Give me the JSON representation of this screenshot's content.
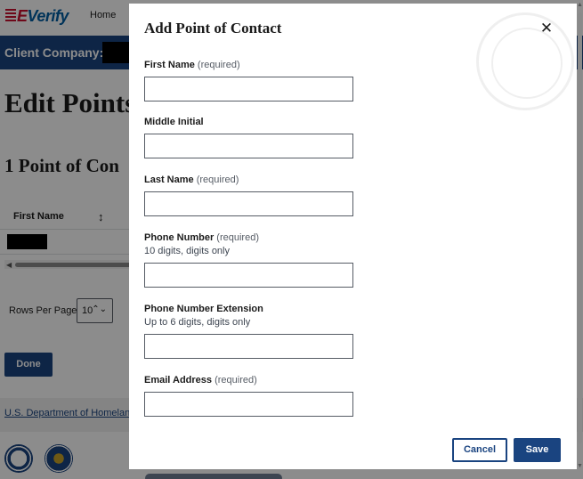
{
  "background": {
    "logo": {
      "prefix": "E",
      "text": "Verify"
    },
    "nav": {
      "home": "Home"
    },
    "client_company_label": "Client Company:",
    "page_title": "Edit Points",
    "poc_count": "1 Point of Con",
    "table": {
      "columns": [
        "First Name"
      ]
    },
    "rows_per_page": {
      "label": "Rows Per Page",
      "value": "10"
    },
    "done_label": "Done",
    "footer_link": "U.S. Department of Homelan"
  },
  "modal": {
    "title": "Add Point of Contact",
    "fields": [
      {
        "label": "First Name",
        "required": "(required)",
        "hint": "",
        "value": ""
      },
      {
        "label": "Middle Initial",
        "required": "",
        "hint": "",
        "value": ""
      },
      {
        "label": "Last Name",
        "required": "(required)",
        "hint": "",
        "value": ""
      },
      {
        "label": "Phone Number",
        "required": "(required)",
        "hint": "10 digits, digits only",
        "value": ""
      },
      {
        "label": "Phone Number Extension",
        "required": "",
        "hint": "Up to 6 digits, digits only",
        "value": ""
      },
      {
        "label": "Email Address",
        "required": "(required)",
        "hint": "",
        "value": ""
      }
    ],
    "cancel_label": "Cancel",
    "save_label": "Save"
  },
  "icons": {
    "close": "close-icon",
    "sort": "sort-icon",
    "chevron": "chevron-up-down-icon"
  },
  "colors": {
    "primary": "#1a4480",
    "brand_red": "#c8102e"
  }
}
